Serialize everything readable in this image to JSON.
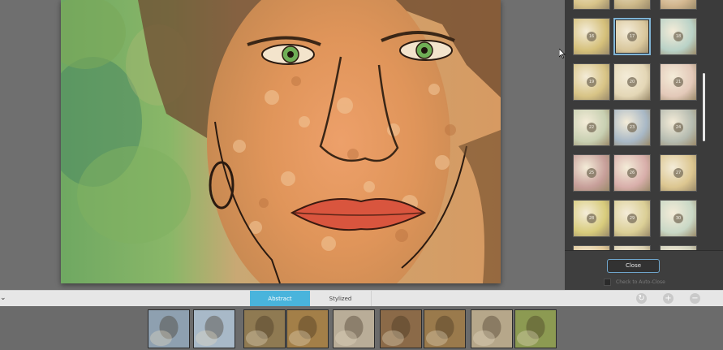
{
  "tabs": {
    "abstract": "Abstract",
    "stylized": "Stylized"
  },
  "panel": {
    "close_label": "Close",
    "auto_close_label": "Check to Auto-Close",
    "selected_texture": "17",
    "textures": [
      {
        "num": "",
        "color": "#d8c48a"
      },
      {
        "num": "",
        "color": "#cdb98a"
      },
      {
        "num": "",
        "color": "#d3b790"
      },
      {
        "num": "16",
        "color": "#d5c07a"
      },
      {
        "num": "17",
        "color": "#d9c79c"
      },
      {
        "num": "18",
        "color": "#b9d2c7"
      },
      {
        "num": "19",
        "color": "#d8c486"
      },
      {
        "num": "20",
        "color": "#e4d7b6"
      },
      {
        "num": "21",
        "color": "#e3c9b9"
      },
      {
        "num": "22",
        "color": "#c8d0b2"
      },
      {
        "num": "23",
        "color": "#a8b8c6"
      },
      {
        "num": "24",
        "color": "#b5bbb0"
      },
      {
        "num": "25",
        "color": "#c79f9a"
      },
      {
        "num": "26",
        "color": "#d8aeaa"
      },
      {
        "num": "27",
        "color": "#dcc690"
      },
      {
        "num": "28",
        "color": "#d8cc7c"
      },
      {
        "num": "29",
        "color": "#dbcf96"
      },
      {
        "num": "30",
        "color": "#c9d8c6"
      },
      {
        "num": "",
        "color": "#e0c89a"
      },
      {
        "num": "",
        "color": "#d9cfb0"
      },
      {
        "num": "",
        "color": "#cfd0bc"
      }
    ]
  },
  "colors": {
    "accent": "#49b4dc",
    "close_border": "#6fa6cc"
  },
  "icons": {
    "collapse": "chevron-down-icon",
    "reset": "reset-icon",
    "zoom_in": "plus-icon",
    "zoom_out": "minus-icon"
  },
  "filmstrip": [
    {
      "name": "filmstrip-thumb-1",
      "color": "#8ea0b0"
    },
    {
      "name": "filmstrip-thumb-2",
      "color": "#a8b9c8"
    },
    {
      "name": "filmstrip-thumb-3",
      "color": "#8f7a52"
    },
    {
      "name": "filmstrip-thumb-4",
      "color": "#a37f48"
    },
    {
      "name": "filmstrip-thumb-5",
      "color": "#b9ad98"
    },
    {
      "name": "filmstrip-thumb-6",
      "color": "#8b6a48"
    },
    {
      "name": "filmstrip-thumb-7",
      "color": "#9a7a4c"
    },
    {
      "name": "filmstrip-thumb-8",
      "color": "#b6a78a"
    },
    {
      "name": "filmstrip-thumb-9",
      "color": "#8c9a52"
    }
  ]
}
